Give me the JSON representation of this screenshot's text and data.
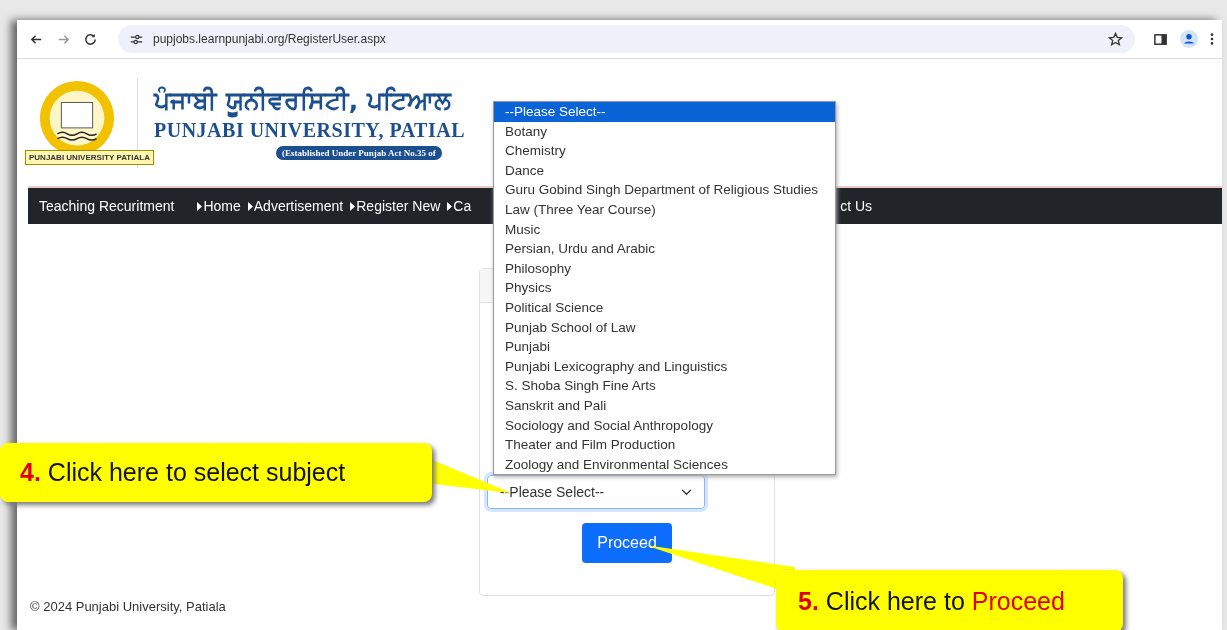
{
  "browser": {
    "url": "pupjobs.learnpunjabi.org/RegisterUser.aspx"
  },
  "header": {
    "title_punjabi": "ਪੰਜਾਬੀ ਯੂਨੀਵਰਸਿਟੀ, ਪਟਿਆਲ",
    "title_english": "PUNJABI UNIVERSITY, PATIAL",
    "established": "(Established Under Punjab Act No.35 of",
    "logo_caption": "PUNJABI UNIVERSITY PATIALA"
  },
  "nav": [
    {
      "label": "Teaching Recuritment",
      "kind": "brand"
    },
    {
      "label": "Home",
      "kind": "link"
    },
    {
      "label": "Advertisement",
      "kind": "link"
    },
    {
      "label": "Register New",
      "kind": "link"
    },
    {
      "label": "Ca",
      "kind": "link"
    },
    {
      "label": "ct Us",
      "kind": "tail"
    }
  ],
  "subject_select": {
    "value": "--Please Select--",
    "expanded": true,
    "options": [
      {
        "label": "--Please Select--",
        "selected": true
      },
      {
        "label": "Botany",
        "selected": false
      },
      {
        "label": "Chemistry",
        "selected": false
      },
      {
        "label": "Dance",
        "selected": false
      },
      {
        "label": "Guru Gobind Singh Department of Religious Studies",
        "selected": false
      },
      {
        "label": "Law (Three Year Course)",
        "selected": false
      },
      {
        "label": "Music",
        "selected": false
      },
      {
        "label": "Persian, Urdu and Arabic",
        "selected": false
      },
      {
        "label": "Philosophy",
        "selected": false
      },
      {
        "label": "Physics",
        "selected": false
      },
      {
        "label": "Political Science",
        "selected": false
      },
      {
        "label": "Punjab School of Law",
        "selected": false
      },
      {
        "label": "Punjabi",
        "selected": false
      },
      {
        "label": "Punjabi Lexicography and Linguistics",
        "selected": false
      },
      {
        "label": "S. Shoba Singh Fine Arts",
        "selected": false
      },
      {
        "label": "Sanskrit and Pali",
        "selected": false
      },
      {
        "label": "Sociology and Social Anthropology",
        "selected": false
      },
      {
        "label": "Theater and Film Production",
        "selected": false
      },
      {
        "label": "Zoology and Environmental Sciences",
        "selected": false
      }
    ]
  },
  "proceed_button": "Proceed",
  "footer": "© 2024 Punjabi University, Patiala",
  "callouts": [
    {
      "number": "4.",
      "text": "Click here to select subject"
    },
    {
      "number": "5.",
      "text": "Click here to",
      "highlight": "Proceed"
    }
  ]
}
